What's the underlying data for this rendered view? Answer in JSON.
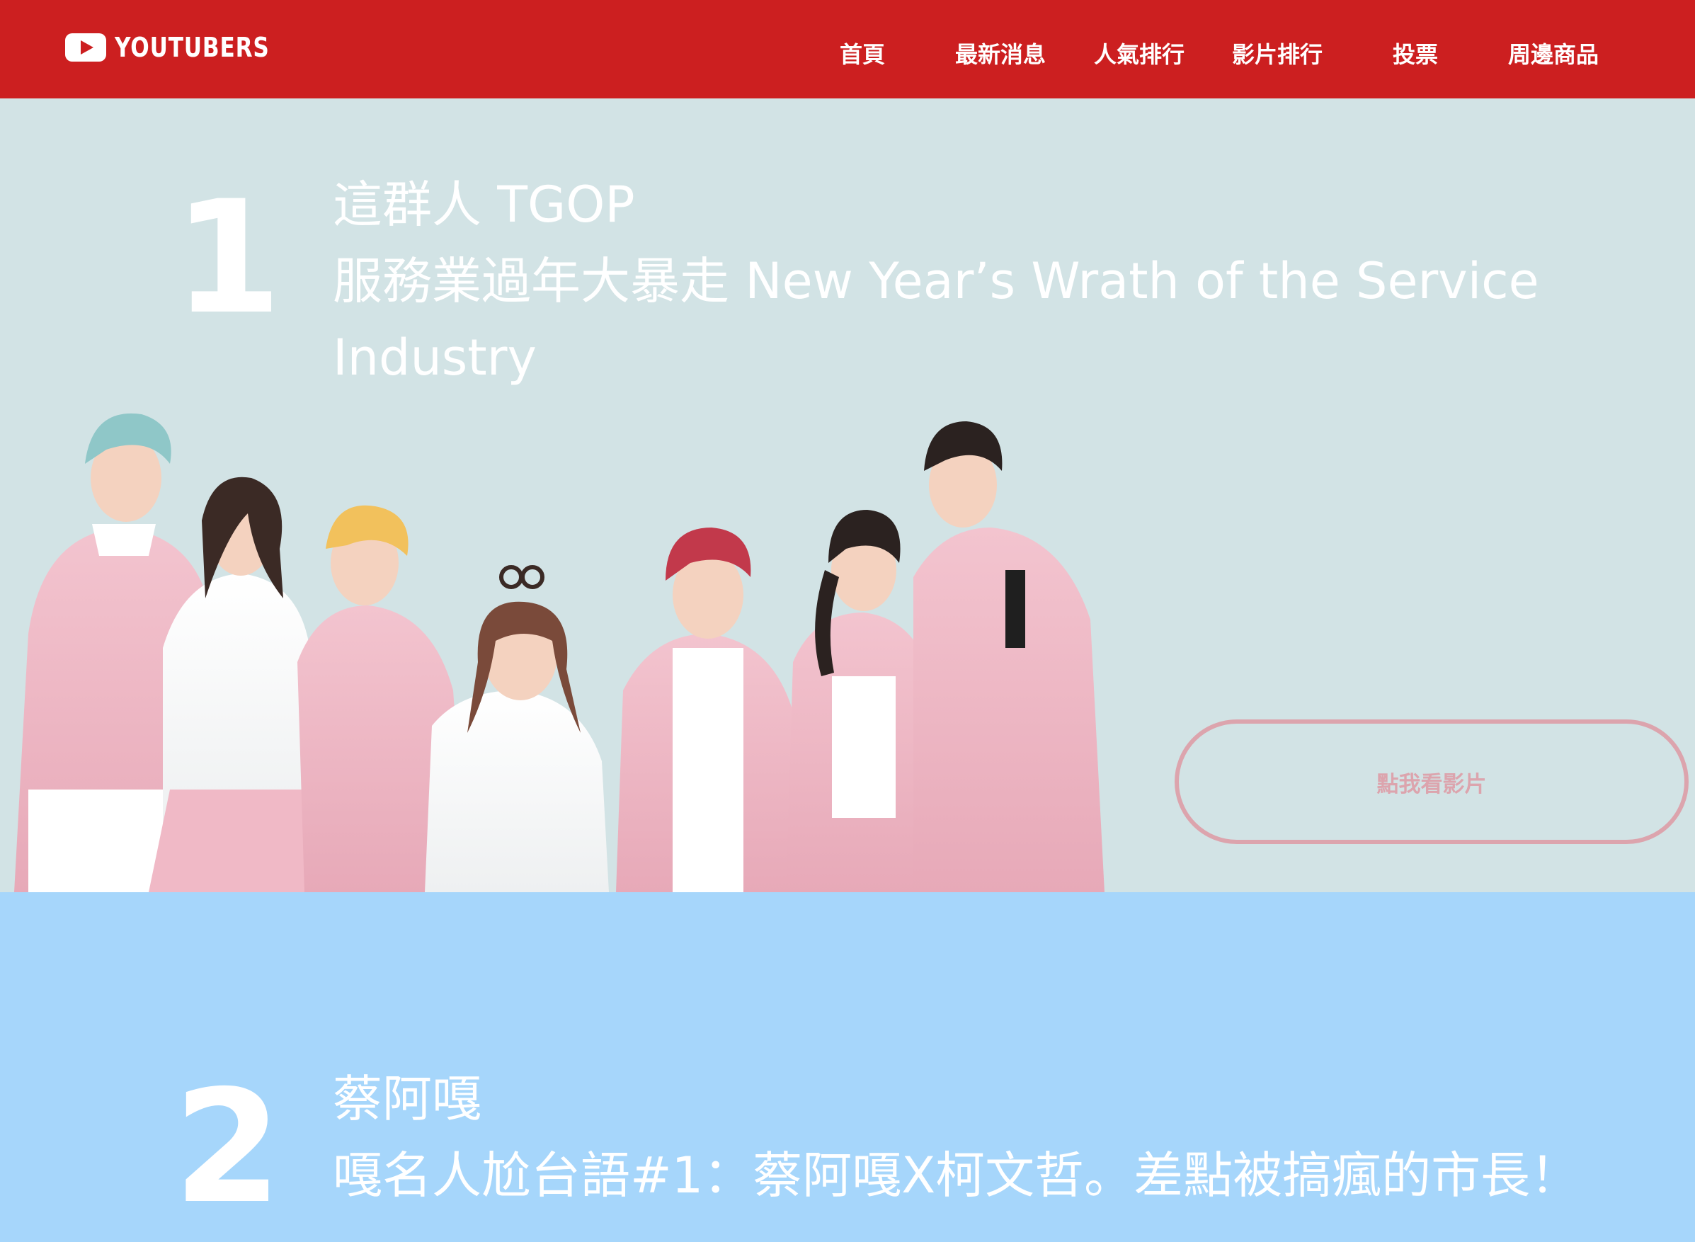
{
  "header": {
    "logo_text": "YOUTUBERS",
    "nav": {
      "home": "首頁",
      "news": "最新消息",
      "popularity": "人氣排行",
      "video_rank": "影片排行",
      "vote": "投票",
      "merch": "周邊商品"
    }
  },
  "rankings": [
    {
      "rank": "1",
      "channel": "這群人 TGOP",
      "video_title_line1": "服務業過年大暴走 New Year’s Wrath of the Service",
      "video_title_line2": "Industry",
      "button_label": "點我看影片"
    },
    {
      "rank": "2",
      "channel": "蔡阿嘎",
      "video_title_line1": "嘎名人尬台語#1：蔡阿嘎X柯文哲。差點被搞瘋的市長！"
    }
  ],
  "colors": {
    "header_bg": "#cc1f20",
    "section1_bg": "#d2e3e5",
    "section2_bg": "#a6d6fb",
    "button_accent": "#dca4ad",
    "outfit_pink": "#f0b9c6"
  },
  "icons": {
    "logo": "youtube-play-icon"
  }
}
